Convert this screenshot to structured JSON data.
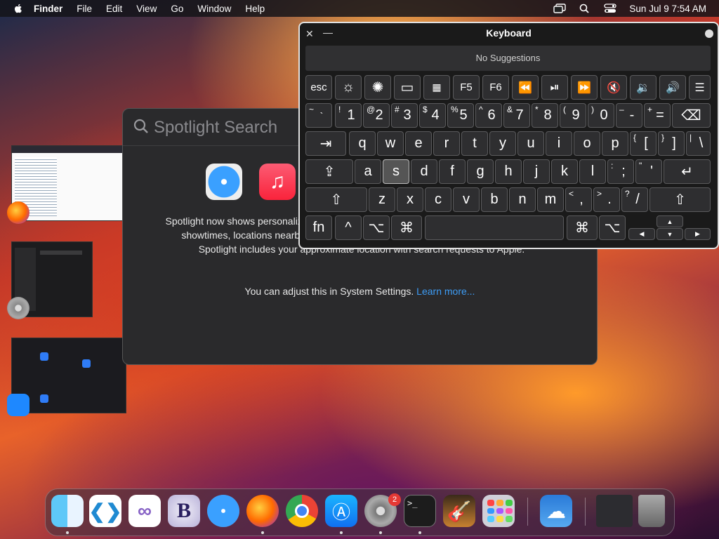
{
  "menubar": {
    "app_name": "Finder",
    "items": [
      "File",
      "Edit",
      "View",
      "Go",
      "Window",
      "Help"
    ],
    "clock": "Sun Jul 9  7:54 AM"
  },
  "spotlight": {
    "placeholder": "Spotlight Search",
    "message": "Spotlight now shows personalized suggestions from the internet, iTunes, App Store, movie showtimes, locations nearby and more. To make suggestions more relevant to you, Spotlight includes your approximate location with search requests to Apple.",
    "settings_text": "You can adjust this in System Settings.",
    "learn_more": "Learn more..."
  },
  "keyboard": {
    "title": "Keyboard",
    "suggestions": "No Suggestions",
    "row1": [
      "esc",
      "F5",
      "F6"
    ],
    "row2": [
      {
        "shift": "~",
        "sub": "`",
        "main": ""
      },
      {
        "shift": "!",
        "main": "1"
      },
      {
        "shift": "@",
        "main": "2"
      },
      {
        "shift": "#",
        "main": "3"
      },
      {
        "shift": "$",
        "main": "4"
      },
      {
        "shift": "%",
        "main": "5"
      },
      {
        "shift": "^",
        "main": "6"
      },
      {
        "shift": "&",
        "main": "7"
      },
      {
        "shift": "*",
        "main": "8"
      },
      {
        "shift": "(",
        "main": "9"
      },
      {
        "shift": ")",
        "main": "0"
      },
      {
        "shift": "–",
        "main": "-"
      },
      {
        "shift": "+",
        "main": "="
      }
    ],
    "row3": [
      "q",
      "w",
      "e",
      "r",
      "t",
      "y",
      "u",
      "i",
      "o",
      "p"
    ],
    "row3_sym": [
      {
        "shift": "{",
        "main": "["
      },
      {
        "shift": "}",
        "main": "]"
      },
      {
        "shift": "|",
        "main": "\\"
      }
    ],
    "row4": [
      "a",
      "s",
      "d",
      "f",
      "g",
      "h",
      "j",
      "k",
      "l"
    ],
    "row4_sym": [
      {
        "shift": ":",
        "main": ";"
      },
      {
        "shift": "\"",
        "main": "'"
      }
    ],
    "row5": [
      "z",
      "x",
      "c",
      "v",
      "b",
      "n",
      "m"
    ],
    "row5_sym": [
      {
        "shift": "<",
        "main": ","
      },
      {
        "shift": ">",
        "main": "."
      },
      {
        "shift": "?",
        "main": "/"
      }
    ],
    "fn": "fn"
  },
  "dock": {
    "badge_count": "2"
  },
  "colors": {
    "link": "#3d9cf5",
    "badge": "#e53935"
  }
}
